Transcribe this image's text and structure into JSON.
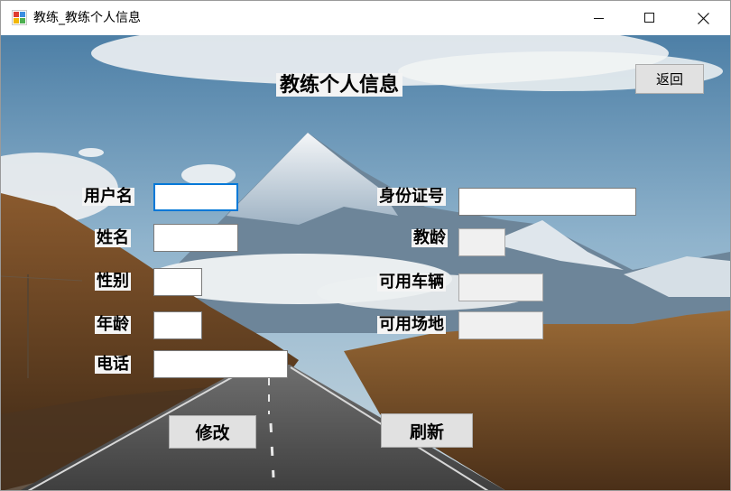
{
  "window": {
    "title": "教练_教练个人信息"
  },
  "form": {
    "heading": "教练个人信息",
    "back_button": "返回",
    "labels": {
      "username": "用户名",
      "name": "姓名",
      "gender": "性别",
      "age": "年龄",
      "phone": "电话",
      "id_number": "身份证号",
      "teaching_years": "教龄",
      "available_vehicle": "可用车辆",
      "available_venue": "可用场地"
    },
    "values": {
      "username": "",
      "name": "",
      "gender": "",
      "age": "",
      "phone": "",
      "id_number": "",
      "teaching_years": "",
      "available_vehicle": "",
      "available_venue": ""
    },
    "modify_button": "修改",
    "refresh_button": "刷新"
  },
  "colors": {
    "focus_border": "#0078d7",
    "button_face": "#e1e1e1",
    "label_bg": "#f4f4f4"
  }
}
